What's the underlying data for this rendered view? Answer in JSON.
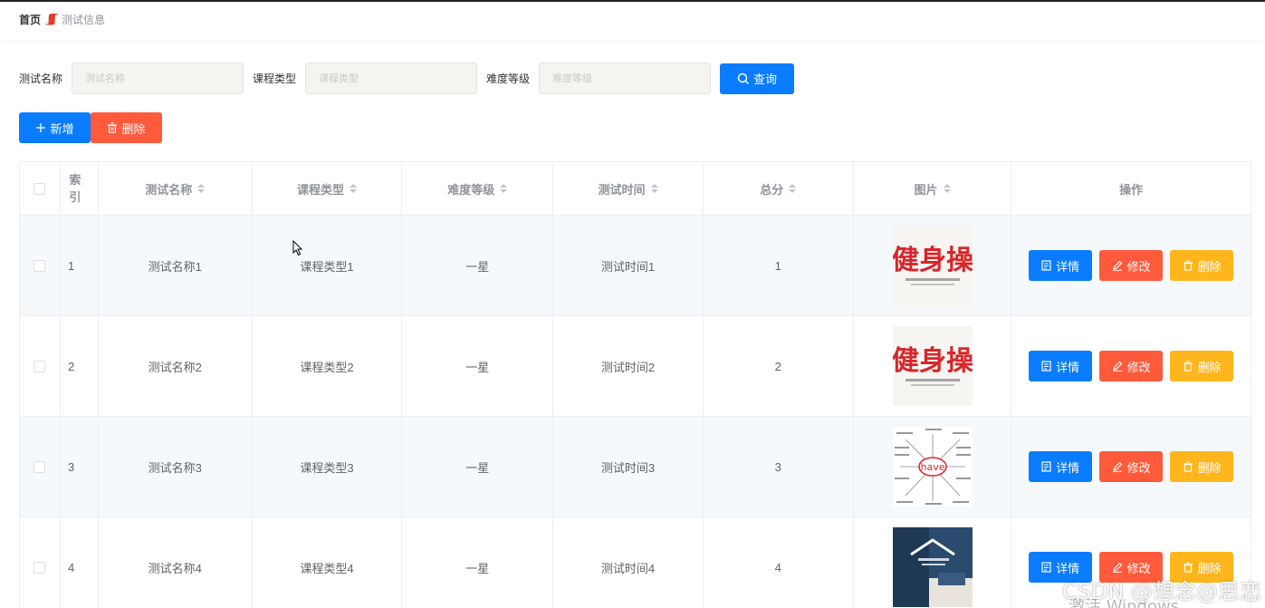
{
  "breadcrumb": {
    "home": "首页",
    "current": "测试信息"
  },
  "search": {
    "fields": [
      {
        "label": "测试名称",
        "placeholder": "测试名称"
      },
      {
        "label": "课程类型",
        "placeholder": "课程类型"
      },
      {
        "label": "难度等级",
        "placeholder": "难度等级"
      }
    ],
    "query_label": "查询"
  },
  "actions": {
    "add_label": "新增",
    "delete_label": "删除"
  },
  "table": {
    "headers": {
      "index": "索引",
      "name": "测试名称",
      "type": "课程类型",
      "level": "难度等级",
      "time": "测试时间",
      "score": "总分",
      "image": "图片",
      "ops": "操作"
    },
    "rows": [
      {
        "index": "1",
        "name": "测试名称1",
        "type": "课程类型1",
        "level": "一星",
        "time": "测试时间1",
        "score": "1",
        "image": "jiancao"
      },
      {
        "index": "2",
        "name": "测试名称2",
        "type": "课程类型2",
        "level": "一星",
        "time": "测试时间2",
        "score": "2",
        "image": "jiancao"
      },
      {
        "index": "3",
        "name": "测试名称3",
        "type": "课程类型3",
        "level": "一星",
        "time": "测试时间3",
        "score": "3",
        "image": "have"
      },
      {
        "index": "4",
        "name": "测试名称4",
        "type": "课程类型4",
        "level": "一星",
        "time": "测试时间4",
        "score": "4",
        "image": "photo"
      }
    ],
    "op_labels": {
      "detail": "详情",
      "edit": "修改",
      "delete": "删除"
    }
  },
  "images": {
    "jiancao_text": "健身操",
    "have_text": "have"
  },
  "watermark": {
    "csdn": "CSDN @想念@思恋",
    "windows": "激活 Windows"
  },
  "colors": {
    "primary": "#0a7cff",
    "danger": "#ff5a3c",
    "warning": "#ffb61c"
  }
}
